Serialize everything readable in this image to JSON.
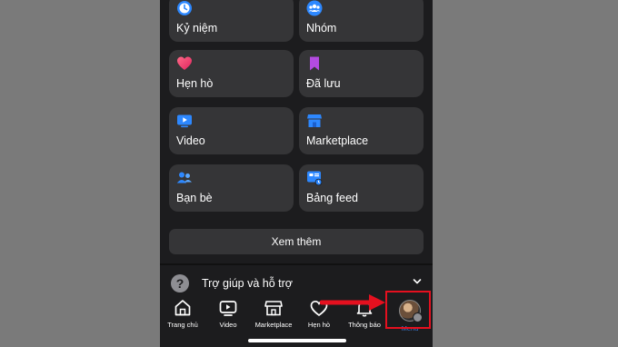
{
  "tiles": [
    {
      "label": "Kỷ niệm",
      "icon": "clock-memories-icon"
    },
    {
      "label": "Nhóm",
      "icon": "groups-icon"
    },
    {
      "label": "Hẹn hò",
      "icon": "heart-dating-icon"
    },
    {
      "label": "Đã lưu",
      "icon": "bookmark-saved-icon"
    },
    {
      "label": "Video",
      "icon": "video-play-icon"
    },
    {
      "label": "Marketplace",
      "icon": "marketplace-store-icon"
    },
    {
      "label": "Bạn bè",
      "icon": "friends-icon"
    },
    {
      "label": "Bảng feed",
      "icon": "feed-icon"
    }
  ],
  "see_more": "Xem thêm",
  "help": {
    "label": "Trợ giúp và hỗ trợ",
    "icon": "question-icon"
  },
  "tabbar": [
    {
      "label": "Trang chủ",
      "icon": "home-icon"
    },
    {
      "label": "Video",
      "icon": "video-icon"
    },
    {
      "label": "Marketplace",
      "icon": "store-icon"
    },
    {
      "label": "Hẹn hò",
      "icon": "heart-icon"
    },
    {
      "label": "Thông báo",
      "icon": "bell-icon"
    },
    {
      "label": "Menu",
      "icon": "avatar"
    }
  ],
  "colors": {
    "accent": "#1877f2",
    "annotation": "#e5101f",
    "background": "#1c1c1e",
    "tile": "#353537"
  }
}
